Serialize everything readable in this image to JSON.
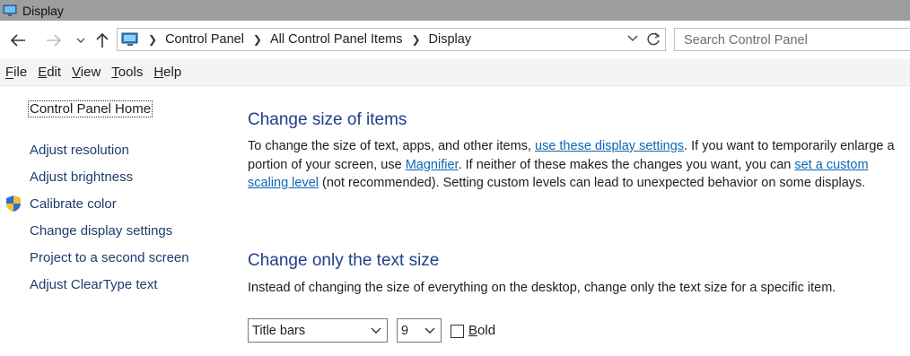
{
  "window": {
    "title": "Display"
  },
  "address": {
    "crumbs": [
      "Control Panel",
      "All Control Panel Items",
      "Display"
    ]
  },
  "search": {
    "placeholder": "Search Control Panel"
  },
  "menu": {
    "file": "File",
    "edit": "Edit",
    "view": "View",
    "tools": "Tools",
    "help": "Help"
  },
  "sidebar": {
    "home": "Control Panel Home",
    "items": [
      "Adjust resolution",
      "Adjust brightness",
      "Calibrate color",
      "Change display settings",
      "Project to a second screen",
      "Adjust ClearType text"
    ]
  },
  "section1": {
    "heading": "Change size of items",
    "text1": "To change the size of text, apps, and other items, ",
    "link1": "use these display settings",
    "text2": ".  If you want to temporarily enlarge a portion of your screen, use ",
    "link2": "Magnifier",
    "text3": ".  If neither of these makes the changes you want, you can ",
    "link3": "set a custom scaling level",
    "text4": " (not recommended).  Setting custom levels can lead to unexpected behavior on some displays."
  },
  "section2": {
    "heading": "Change only the text size",
    "description": "Instead of changing the size of everything on the desktop, change only the text size for a specific item.",
    "item_select": "Title bars",
    "size_select": "9",
    "bold_label": "Bold",
    "bold_checked": false
  },
  "colors": {
    "titlebar": "#9e9e9e",
    "heading": "#1e3f8a",
    "link": "#0e66b5"
  }
}
